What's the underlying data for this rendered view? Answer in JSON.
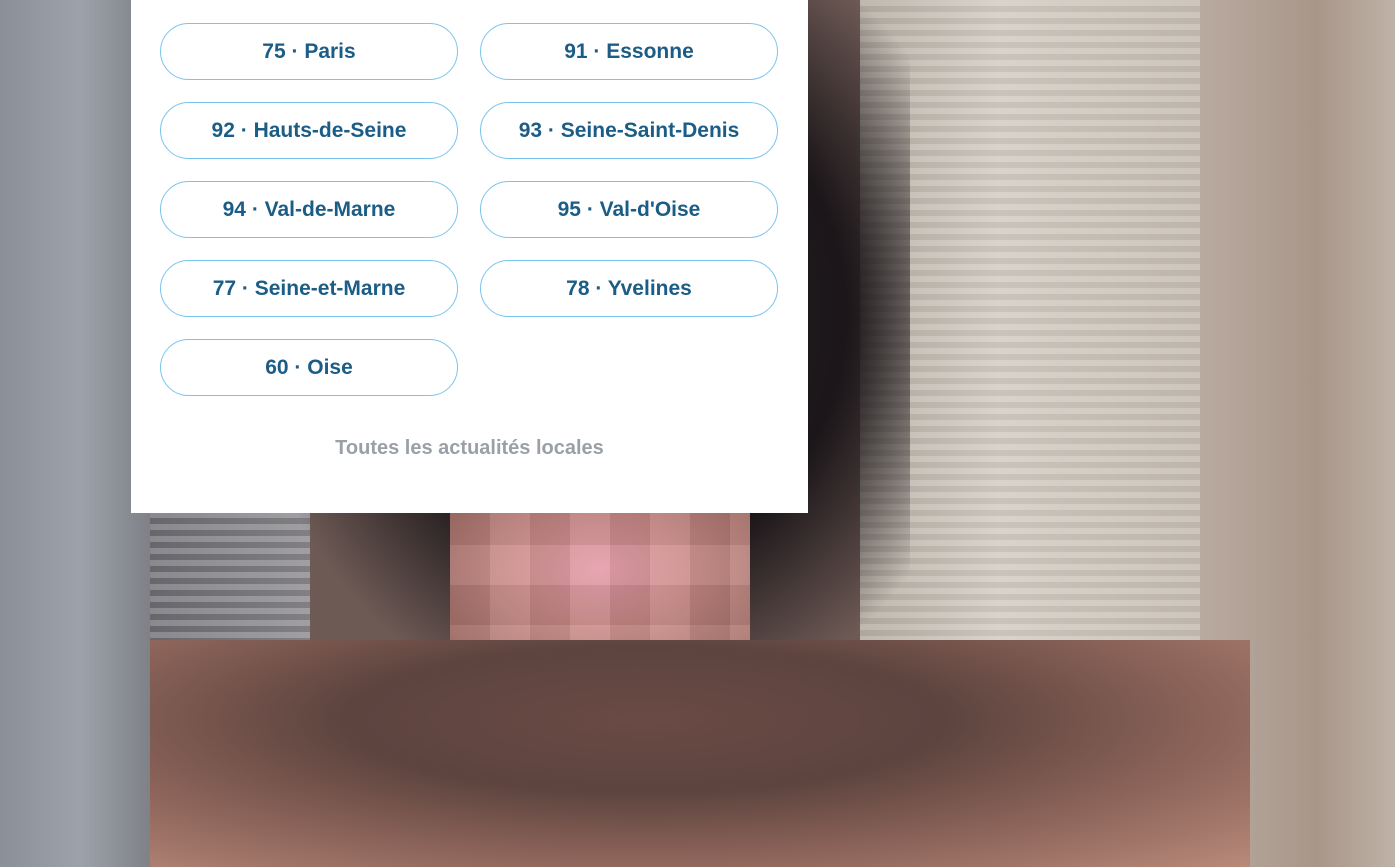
{
  "departments": [
    {
      "label": "75 · Paris"
    },
    {
      "label": "91 · Essonne"
    },
    {
      "label": "92 · Hauts-de-Seine"
    },
    {
      "label": "93 · Seine-Saint-Denis"
    },
    {
      "label": "94 · Val-de-Marne"
    },
    {
      "label": "95 · Val-d'Oise"
    },
    {
      "label": "77 · Seine-et-Marne"
    },
    {
      "label": "78 · Yvelines"
    },
    {
      "label": "60 · Oise"
    }
  ],
  "all_news_link": "Toutes les actualités locales",
  "colors": {
    "button_text": "#1b5d86",
    "button_border": "#7cc4ee",
    "link_text": "#9aa0a6",
    "panel_bg": "#ffffff"
  }
}
